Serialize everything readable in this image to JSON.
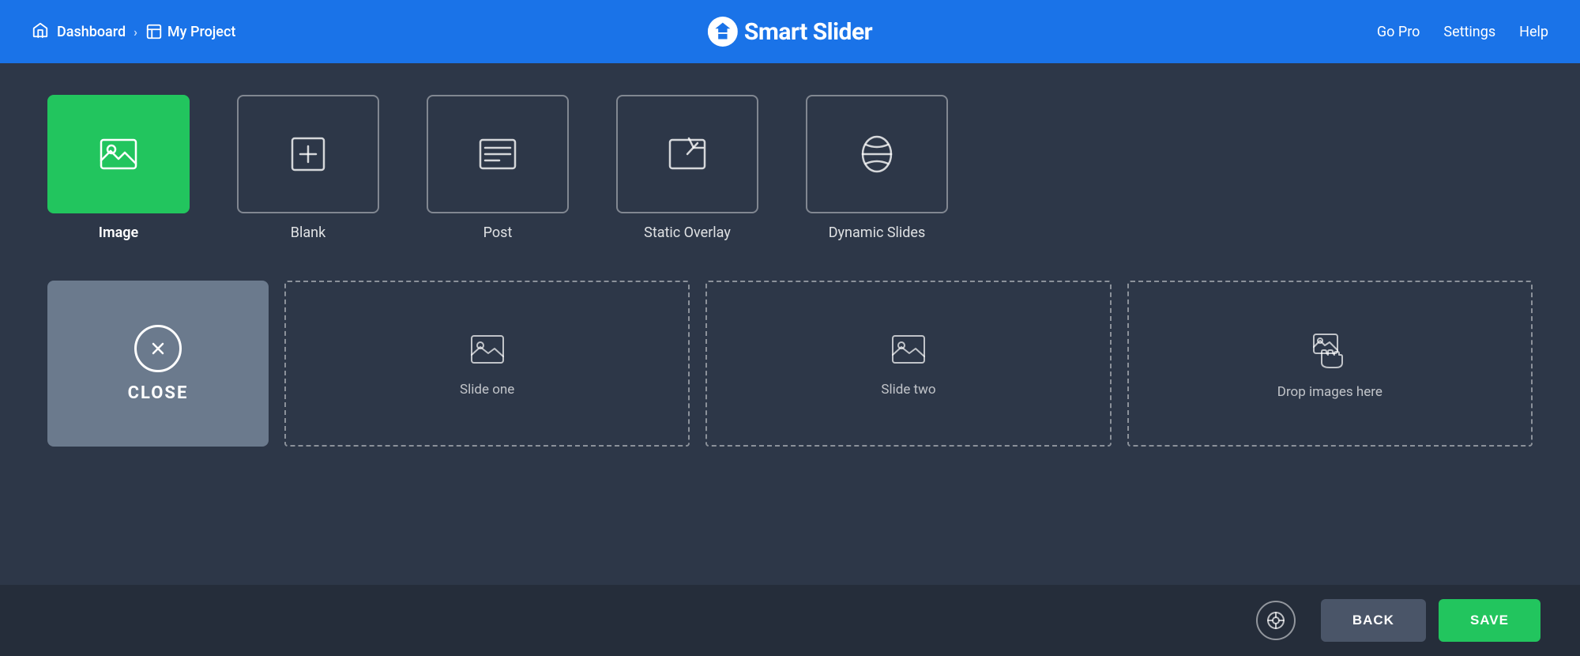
{
  "header": {
    "dashboard_label": "Dashboard",
    "project_label": "My Project",
    "logo_text": "Smart Slider",
    "go_pro_label": "Go Pro",
    "settings_label": "Settings",
    "help_label": "Help"
  },
  "slide_types": [
    {
      "id": "image",
      "label": "Image",
      "active": true
    },
    {
      "id": "blank",
      "label": "Blank",
      "active": false
    },
    {
      "id": "post",
      "label": "Post",
      "active": false
    },
    {
      "id": "static_overlay",
      "label": "Static Overlay",
      "active": false
    },
    {
      "id": "dynamic_slides",
      "label": "Dynamic Slides",
      "active": false
    }
  ],
  "close_tile": {
    "label": "CLOSE"
  },
  "slides": [
    {
      "id": "slide_one",
      "label": "Slide one"
    },
    {
      "id": "slide_two",
      "label": "Slide two"
    }
  ],
  "drop_zone": {
    "label": "Drop images here"
  },
  "footer": {
    "back_label": "BACK",
    "save_label": "SAVE"
  },
  "colors": {
    "active_green": "#22c55e",
    "header_blue": "#1a73e8",
    "dark_bg": "#2d3748",
    "footer_bg": "#252d3a",
    "close_tile_bg": "#6b7a8d"
  }
}
